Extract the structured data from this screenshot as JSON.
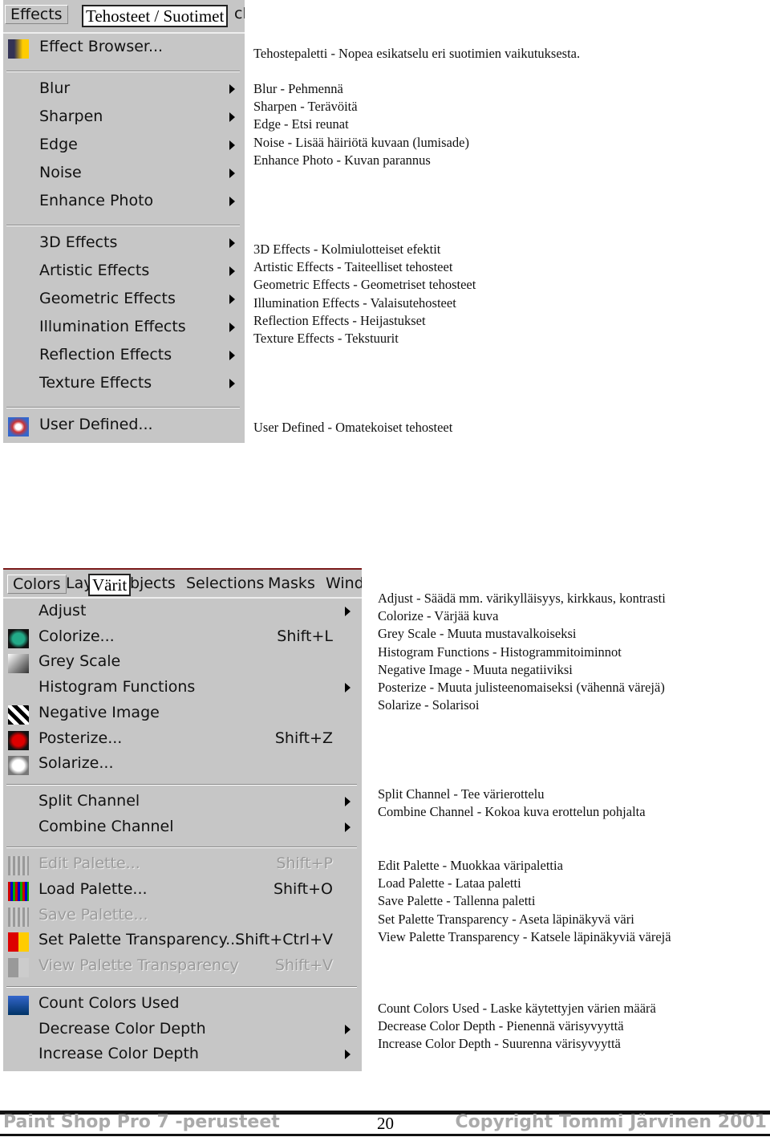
{
  "effects_menu": {
    "menubar": [
      "Effects"
    ],
    "menubar_cut": "cl",
    "overlay_label": "Tehosteet / Suotimet",
    "groups": [
      [
        {
          "label": "Effect Browser...",
          "icon": "effect-browser-icon"
        }
      ],
      [
        {
          "label": "Blur",
          "submenu": true
        },
        {
          "label": "Sharpen",
          "submenu": true
        },
        {
          "label": "Edge",
          "submenu": true
        },
        {
          "label": "Noise",
          "submenu": true
        },
        {
          "label": "Enhance Photo",
          "submenu": true
        }
      ],
      [
        {
          "label": "3D Effects",
          "submenu": true
        },
        {
          "label": "Artistic Effects",
          "submenu": true
        },
        {
          "label": "Geometric Effects",
          "submenu": true
        },
        {
          "label": "Illumination Effects",
          "submenu": true
        },
        {
          "label": "Reflection Effects",
          "submenu": true
        },
        {
          "label": "Texture Effects",
          "submenu": true
        }
      ],
      [
        {
          "label": "User Defined...",
          "icon": "user-defined-icon"
        }
      ]
    ]
  },
  "effects_descriptions": [
    [
      "Tehostepaletti - Nopea esikatselu eri suotimien vaikutuksesta."
    ],
    [
      "Blur - Pehmennä",
      "Sharpen - Terävöitä",
      "Edge - Etsi reunat",
      "Noise - Lisää häiriötä kuvaan (lumisade)",
      "Enhance Photo - Kuvan parannus"
    ],
    [
      "3D Effects - Kolmiulotteiset efektit",
      "Artistic Effects - Taiteelliset tehosteet",
      "Geometric Effects - Geometriset tehosteet",
      "Illumination Effects - Valaisutehosteet",
      "Reflection Effects - Heijastukset",
      "Texture Effects - Tekstuurit"
    ],
    [
      "User Defined - Omatekoiset tehosteet"
    ]
  ],
  "colors_menu": {
    "menubar": [
      "Colors",
      "Lay",
      "bjects",
      "Selections",
      "Masks",
      "Wind"
    ],
    "overlay_label": "Värit",
    "groups": [
      [
        {
          "label": "Adjust",
          "submenu": true
        },
        {
          "label": "Colorize...",
          "shortcut": "Shift+L",
          "icon": "colorize-icon"
        },
        {
          "label": "Grey Scale",
          "icon": "grey-scale-icon"
        },
        {
          "label": "Histogram Functions",
          "submenu": true
        },
        {
          "label": "Negative Image",
          "icon": "negative-image-icon"
        },
        {
          "label": "Posterize...",
          "shortcut": "Shift+Z",
          "icon": "posterize-icon"
        },
        {
          "label": "Solarize...",
          "icon": "solarize-icon"
        }
      ],
      [
        {
          "label": "Split Channel",
          "submenu": true
        },
        {
          "label": "Combine Channel",
          "submenu": true
        }
      ],
      [
        {
          "label": "Edit Palette...",
          "shortcut": "Shift+P",
          "disabled": true,
          "icon": "edit-palette-icon"
        },
        {
          "label": "Load Palette...",
          "shortcut": "Shift+O",
          "icon": "load-palette-icon"
        },
        {
          "label": "Save Palette...",
          "disabled": true,
          "icon": "save-palette-icon"
        },
        {
          "label": "Set Palette Transparency...",
          "shortcut": "Shift+Ctrl+V",
          "icon": "palette-transparency-icon"
        },
        {
          "label": "View Palette Transparency",
          "shortcut": "Shift+V",
          "disabled": true,
          "icon": "view-transparency-icon"
        }
      ],
      [
        {
          "label": "Count Colors Used",
          "icon": "count-colors-icon"
        },
        {
          "label": "Decrease Color Depth",
          "submenu": true
        },
        {
          "label": "Increase Color Depth",
          "submenu": true
        }
      ]
    ]
  },
  "colors_descriptions": [
    [
      "Adjust - Säädä mm. värikylläisyys, kirkkaus, kontrasti",
      "Colorize - Värjää kuva",
      "Grey Scale - Muuta mustavalkoiseksi",
      "Histogram Functions - Histogrammitoiminnot",
      "Negative Image - Muuta negatiiviksi",
      "Posterize - Muuta julisteenomaiseksi (vähennä värejä)",
      "Solarize - Solarisoi"
    ],
    [
      "Split Channel - Tee värierottelu",
      "Combine Channel - Kokoa kuva erottelun pohjalta"
    ],
    [
      "Edit Palette - Muokkaa väripalettia",
      "Load Palette - Lataa paletti",
      "Save Palette - Tallenna paletti",
      "Set Palette Transparency - Aseta läpinäkyvä väri",
      "View Palette Transparency - Katsele läpinäkyviä värejä"
    ],
    [
      "Count Colors Used - Laske käytettyjen värien määrä",
      "Decrease Color Depth - Pienennä värisyvyyttä",
      "Increase Color Depth - Suurenna värisyvyyttä"
    ]
  ],
  "footer": {
    "left": "Paint Shop Pro 7 -perusteet",
    "page": "20",
    "right": "Copyright Tommi Järvinen 2001"
  }
}
